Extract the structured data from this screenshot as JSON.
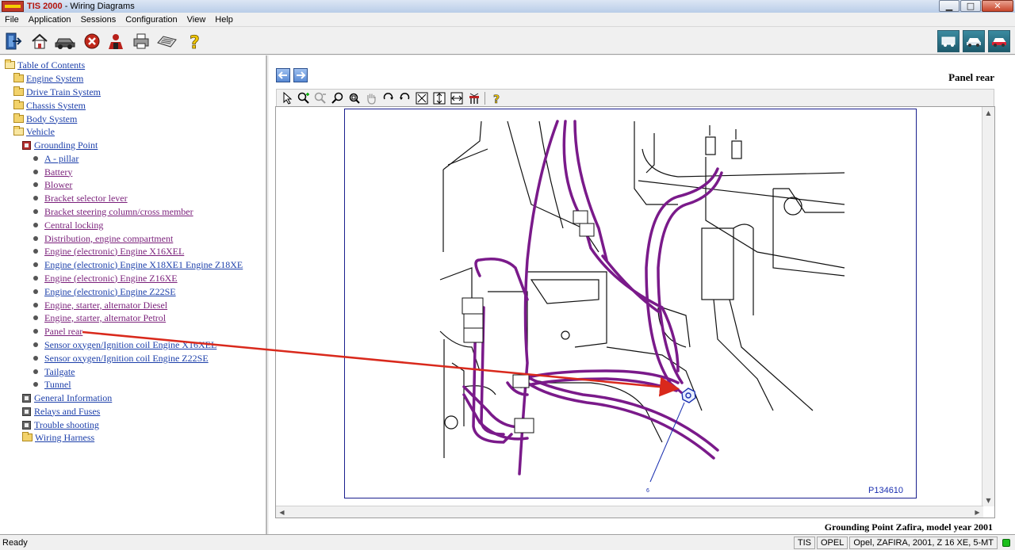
{
  "window": {
    "app_name": "TIS 2000",
    "title_rest": " - Wiring Diagrams",
    "minimize": "▁",
    "maximize": "□",
    "close": "✕"
  },
  "menu": [
    "File",
    "Application",
    "Sessions",
    "Configuration",
    "View",
    "Help"
  ],
  "toolbar": {
    "left_icons": [
      "exit-icon",
      "home-icon",
      "vehicle-icon",
      "stop-icon",
      "user-icon",
      "print-icon",
      "keyboard-icon",
      "help-icon"
    ],
    "right_icons": [
      "diagnostic-tool-icon",
      "vehicle-service-icon",
      "vehicle-info-icon"
    ]
  },
  "tree": {
    "root": "Table of Contents",
    "level1": [
      "Engine System",
      "Drive Train System",
      "Chassis System",
      "Body System",
      "Vehicle"
    ],
    "vehicle_children_top": "Grounding Point",
    "grounding_items": [
      "A - pillar",
      "Battery",
      "Blower",
      "Bracket selector lever",
      "Bracket steering column/cross member",
      "Central locking",
      "Distribution, engine compartment",
      "Engine (electronic) Engine X16XEL",
      "Engine (electronic) Engine X18XE1 Engine Z18XE",
      "Engine (electronic) Engine Z16XE",
      "Engine (electronic) Engine Z22SE",
      "Engine, starter, alternator Diesel",
      "Engine, starter, alternator Petrol",
      "Panel rear",
      "Sensor oxygen/Ignition coil Engine X16XEL",
      "Sensor oxygen/Ignition coil Engine Z22SE",
      "Tailgate",
      "Tunnel"
    ],
    "vehicle_children_bottom": [
      "General Information",
      "Relays and Fuses",
      "Trouble shooting",
      "Wiring Harness"
    ]
  },
  "viewer": {
    "title": "Panel rear",
    "image_id": "P134610",
    "callout_number": "6",
    "caption": "Grounding Point Zafira, model year 2001"
  },
  "status": {
    "ready": "Ready",
    "cells": [
      "TIS",
      "OPEL",
      "Opel, ZAFIRA, 2001, Z 16 XE, 5-MT"
    ]
  },
  "colors": {
    "link": "#1c3faa",
    "visited_link": "#7a1f7a",
    "harness": "#7a1a8a",
    "arrow": "#d9291c",
    "frame": "#1a1f8e"
  }
}
